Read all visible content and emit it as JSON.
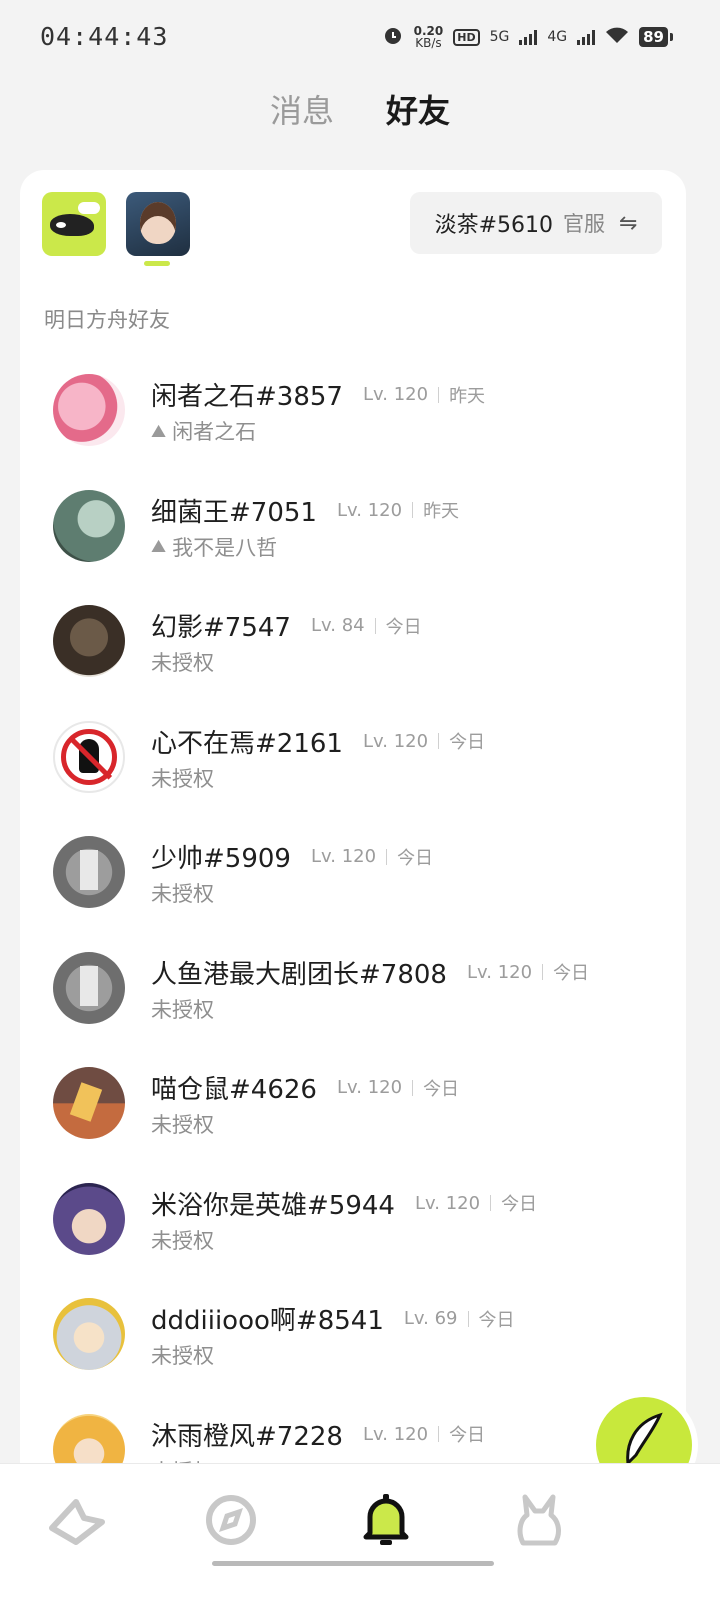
{
  "status": {
    "time": "04:44:43",
    "net_speed": "0.20",
    "net_unit": "KB/s",
    "hd": "HD",
    "sim1": "5G",
    "sim2": "4G",
    "battery": "89"
  },
  "top_tabs": [
    {
      "label": "消息",
      "active": false
    },
    {
      "label": "好友",
      "active": true
    }
  ],
  "games": [
    {
      "icon": "skland-whale-icon"
    },
    {
      "icon": "arknights-game-icon"
    }
  ],
  "account": {
    "name": "淡茶#5610",
    "server": "官服",
    "switch_icon": "swap-icon"
  },
  "section_title": "明日方舟好友",
  "friends": [
    {
      "name": "闲者之石#3857",
      "level": "Lv. 120",
      "time": "昨天",
      "sub": "闲者之石",
      "linked": true
    },
    {
      "name": "细菌王#7051",
      "level": "Lv. 120",
      "time": "昨天",
      "sub": "我不是八哲",
      "linked": true
    },
    {
      "name": "幻影#7547",
      "level": "Lv. 84",
      "time": "今日",
      "sub": "未授权",
      "linked": false
    },
    {
      "name": "心不在焉#2161",
      "level": "Lv. 120",
      "time": "今日",
      "sub": "未授权",
      "linked": false
    },
    {
      "name": "少帅#5909",
      "level": "Lv. 120",
      "time": "今日",
      "sub": "未授权",
      "linked": false
    },
    {
      "name": "人鱼港最大剧团长#7808",
      "level": "Lv. 120",
      "time": "今日",
      "sub": "未授权",
      "linked": false
    },
    {
      "name": "喵仓鼠#4626",
      "level": "Lv. 120",
      "time": "今日",
      "sub": "未授权",
      "linked": false
    },
    {
      "name": "米浴你是英雄#5944",
      "level": "Lv. 120",
      "time": "今日",
      "sub": "未授权",
      "linked": false
    },
    {
      "name": "dddiiiooo啊#8541",
      "level": "Lv. 69",
      "time": "今日",
      "sub": "未授权",
      "linked": false
    },
    {
      "name": "沐雨橙风#7228",
      "level": "Lv. 120",
      "time": "今日",
      "sub": "未授权",
      "linked": false
    }
  ],
  "bottom_nav": [
    {
      "icon": "home-plane-icon",
      "active": false
    },
    {
      "icon": "discover-compass-icon",
      "active": false
    },
    {
      "icon": "bell-icon",
      "active": true
    },
    {
      "icon": "profile-bunny-icon",
      "active": false
    }
  ],
  "fab": {
    "icon": "feather-pen-icon"
  },
  "colors": {
    "accent": "#cbe84a",
    "background": "#f3f3f3",
    "card": "#ffffff"
  }
}
